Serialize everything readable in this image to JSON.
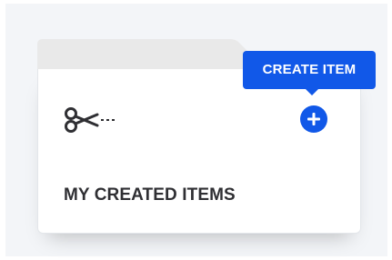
{
  "folder": {
    "label": "MY CREATED ITEMS",
    "icon": "scissors-icon"
  },
  "create_item": {
    "tooltip_label": "CREATE ITEM",
    "button_icon": "plus-icon"
  },
  "colors": {
    "accent": "#1158e8",
    "background": "#f3f5f8",
    "folder_tab": "#e9e9e9",
    "text": "#2f2f33"
  }
}
